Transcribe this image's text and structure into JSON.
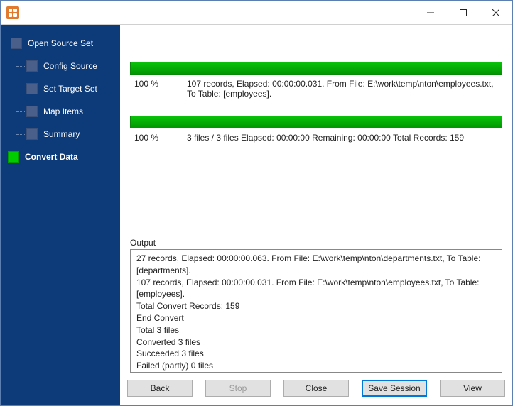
{
  "sidebar": {
    "items": [
      {
        "label": "Open Source Set"
      },
      {
        "label": "Config Source"
      },
      {
        "label": "Set Target Set"
      },
      {
        "label": "Map Items"
      },
      {
        "label": "Summary"
      },
      {
        "label": "Convert Data"
      }
    ]
  },
  "progress1": {
    "percent": "100 %",
    "line1": "107 records,    Elapsed: 00:00:00.031.    From File: E:\\work\\temp\\nton\\employees.txt,",
    "line2": "To Table: [employees]."
  },
  "progress2": {
    "percent": "100 %",
    "line1": "3 files / 3 files    Elapsed: 00:00:00    Remaining: 00:00:00    Total Records: 159"
  },
  "output": {
    "label": "Output",
    "lines": [
      "27 records,    Elapsed: 00:00:00.063.    From File: E:\\work\\temp\\nton\\departments.txt,    To Table: [departments].",
      "107 records,    Elapsed: 00:00:00.031.    From File: E:\\work\\temp\\nton\\employees.txt,    To Table: [employees].",
      "Total Convert Records: 159",
      "End Convert",
      "Total 3 files",
      "Converted 3 files",
      "Succeeded 3 files",
      "Failed (partly) 0 files"
    ]
  },
  "buttons": {
    "back": "Back",
    "stop": "Stop",
    "close": "Close",
    "save_session": "Save Session",
    "view": "View"
  }
}
